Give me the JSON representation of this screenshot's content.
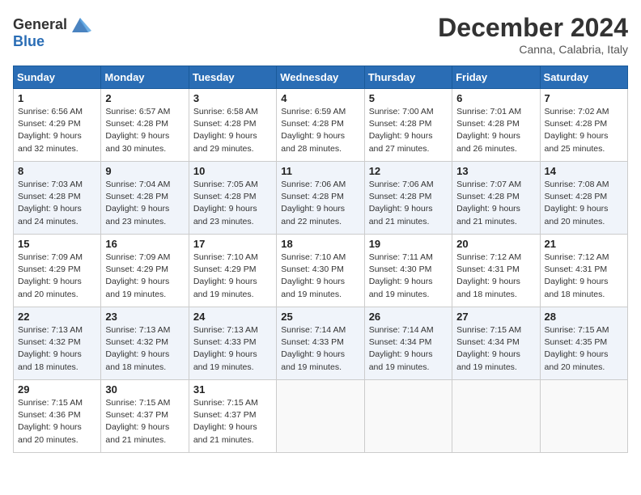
{
  "header": {
    "logo_general": "General",
    "logo_blue": "Blue",
    "title": "December 2024",
    "subtitle": "Canna, Calabria, Italy"
  },
  "weekdays": [
    "Sunday",
    "Monday",
    "Tuesday",
    "Wednesday",
    "Thursday",
    "Friday",
    "Saturday"
  ],
  "weeks": [
    [
      {
        "day": "1",
        "sunrise": "6:56 AM",
        "sunset": "4:29 PM",
        "daylight": "9 hours and 32 minutes."
      },
      {
        "day": "2",
        "sunrise": "6:57 AM",
        "sunset": "4:28 PM",
        "daylight": "9 hours and 30 minutes."
      },
      {
        "day": "3",
        "sunrise": "6:58 AM",
        "sunset": "4:28 PM",
        "daylight": "9 hours and 29 minutes."
      },
      {
        "day": "4",
        "sunrise": "6:59 AM",
        "sunset": "4:28 PM",
        "daylight": "9 hours and 28 minutes."
      },
      {
        "day": "5",
        "sunrise": "7:00 AM",
        "sunset": "4:28 PM",
        "daylight": "9 hours and 27 minutes."
      },
      {
        "day": "6",
        "sunrise": "7:01 AM",
        "sunset": "4:28 PM",
        "daylight": "9 hours and 26 minutes."
      },
      {
        "day": "7",
        "sunrise": "7:02 AM",
        "sunset": "4:28 PM",
        "daylight": "9 hours and 25 minutes."
      }
    ],
    [
      {
        "day": "8",
        "sunrise": "7:03 AM",
        "sunset": "4:28 PM",
        "daylight": "9 hours and 24 minutes."
      },
      {
        "day": "9",
        "sunrise": "7:04 AM",
        "sunset": "4:28 PM",
        "daylight": "9 hours and 23 minutes."
      },
      {
        "day": "10",
        "sunrise": "7:05 AM",
        "sunset": "4:28 PM",
        "daylight": "9 hours and 23 minutes."
      },
      {
        "day": "11",
        "sunrise": "7:06 AM",
        "sunset": "4:28 PM",
        "daylight": "9 hours and 22 minutes."
      },
      {
        "day": "12",
        "sunrise": "7:06 AM",
        "sunset": "4:28 PM",
        "daylight": "9 hours and 21 minutes."
      },
      {
        "day": "13",
        "sunrise": "7:07 AM",
        "sunset": "4:28 PM",
        "daylight": "9 hours and 21 minutes."
      },
      {
        "day": "14",
        "sunrise": "7:08 AM",
        "sunset": "4:28 PM",
        "daylight": "9 hours and 20 minutes."
      }
    ],
    [
      {
        "day": "15",
        "sunrise": "7:09 AM",
        "sunset": "4:29 PM",
        "daylight": "9 hours and 20 minutes."
      },
      {
        "day": "16",
        "sunrise": "7:09 AM",
        "sunset": "4:29 PM",
        "daylight": "9 hours and 19 minutes."
      },
      {
        "day": "17",
        "sunrise": "7:10 AM",
        "sunset": "4:29 PM",
        "daylight": "9 hours and 19 minutes."
      },
      {
        "day": "18",
        "sunrise": "7:10 AM",
        "sunset": "4:30 PM",
        "daylight": "9 hours and 19 minutes."
      },
      {
        "day": "19",
        "sunrise": "7:11 AM",
        "sunset": "4:30 PM",
        "daylight": "9 hours and 19 minutes."
      },
      {
        "day": "20",
        "sunrise": "7:12 AM",
        "sunset": "4:31 PM",
        "daylight": "9 hours and 18 minutes."
      },
      {
        "day": "21",
        "sunrise": "7:12 AM",
        "sunset": "4:31 PM",
        "daylight": "9 hours and 18 minutes."
      }
    ],
    [
      {
        "day": "22",
        "sunrise": "7:13 AM",
        "sunset": "4:32 PM",
        "daylight": "9 hours and 18 minutes."
      },
      {
        "day": "23",
        "sunrise": "7:13 AM",
        "sunset": "4:32 PM",
        "daylight": "9 hours and 18 minutes."
      },
      {
        "day": "24",
        "sunrise": "7:13 AM",
        "sunset": "4:33 PM",
        "daylight": "9 hours and 19 minutes."
      },
      {
        "day": "25",
        "sunrise": "7:14 AM",
        "sunset": "4:33 PM",
        "daylight": "9 hours and 19 minutes."
      },
      {
        "day": "26",
        "sunrise": "7:14 AM",
        "sunset": "4:34 PM",
        "daylight": "9 hours and 19 minutes."
      },
      {
        "day": "27",
        "sunrise": "7:15 AM",
        "sunset": "4:34 PM",
        "daylight": "9 hours and 19 minutes."
      },
      {
        "day": "28",
        "sunrise": "7:15 AM",
        "sunset": "4:35 PM",
        "daylight": "9 hours and 20 minutes."
      }
    ],
    [
      {
        "day": "29",
        "sunrise": "7:15 AM",
        "sunset": "4:36 PM",
        "daylight": "9 hours and 20 minutes."
      },
      {
        "day": "30",
        "sunrise": "7:15 AM",
        "sunset": "4:37 PM",
        "daylight": "9 hours and 21 minutes."
      },
      {
        "day": "31",
        "sunrise": "7:15 AM",
        "sunset": "4:37 PM",
        "daylight": "9 hours and 21 minutes."
      },
      null,
      null,
      null,
      null
    ]
  ],
  "labels": {
    "sunrise": "Sunrise:",
    "sunset": "Sunset:",
    "daylight": "Daylight:"
  }
}
